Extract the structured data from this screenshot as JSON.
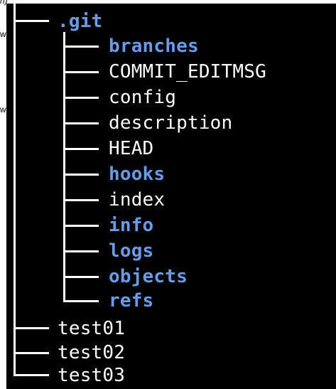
{
  "colors": {
    "background": "#000000",
    "directory": "#6b9be8",
    "file": "#ffffff",
    "lines": "#ffffff"
  },
  "fragments": {
    "top_left": "n)",
    "left_1": "w.A",
    "left_2": "w.l"
  },
  "tree": {
    "root": {
      "name": ".git",
      "type": "dir"
    },
    "children": [
      {
        "name": "branches",
        "type": "dir"
      },
      {
        "name": "COMMIT_EDITMSG",
        "type": "file"
      },
      {
        "name": "config",
        "type": "file"
      },
      {
        "name": "description",
        "type": "file"
      },
      {
        "name": "HEAD",
        "type": "file"
      },
      {
        "name": "hooks",
        "type": "dir"
      },
      {
        "name": "index",
        "type": "file"
      },
      {
        "name": "info",
        "type": "dir"
      },
      {
        "name": "logs",
        "type": "dir"
      },
      {
        "name": "objects",
        "type": "dir"
      },
      {
        "name": "refs",
        "type": "dir"
      }
    ],
    "siblings": [
      {
        "name": "test01",
        "type": "file"
      },
      {
        "name": "test02",
        "type": "file"
      },
      {
        "name": "test03",
        "type": "file"
      }
    ]
  }
}
